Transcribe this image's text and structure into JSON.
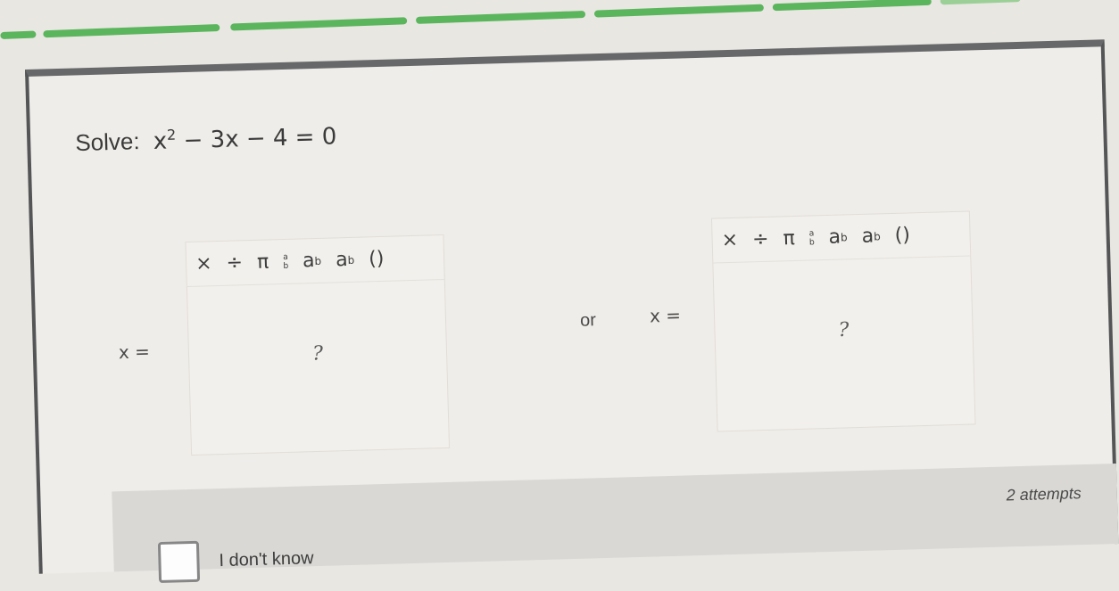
{
  "progress": {
    "segments": [
      "done",
      "done",
      "done",
      "done",
      "done",
      "done",
      "pending"
    ]
  },
  "question": {
    "prefix": "Solve:",
    "equation_main": "x",
    "equation_power": "2",
    "equation_rest": "− 3x − 4 = 0"
  },
  "answer_1": {
    "label": "x =",
    "placeholder": "?",
    "toolbar": [
      "×",
      "÷",
      "π",
      "a",
      "b",
      "a",
      "b",
      "a",
      "b",
      "()"
    ]
  },
  "answer_2": {
    "label": "x =",
    "placeholder": "?",
    "toolbar": [
      "×",
      "÷",
      "π",
      "a",
      "b",
      "a",
      "b",
      "a",
      "b",
      "()"
    ]
  },
  "or_text": "or",
  "footer": {
    "attempts": "2 attempts",
    "dont_know_label": "I don't know"
  },
  "colors": {
    "progress_done": "#5bb55d",
    "progress_pending": "#9ccf98"
  }
}
